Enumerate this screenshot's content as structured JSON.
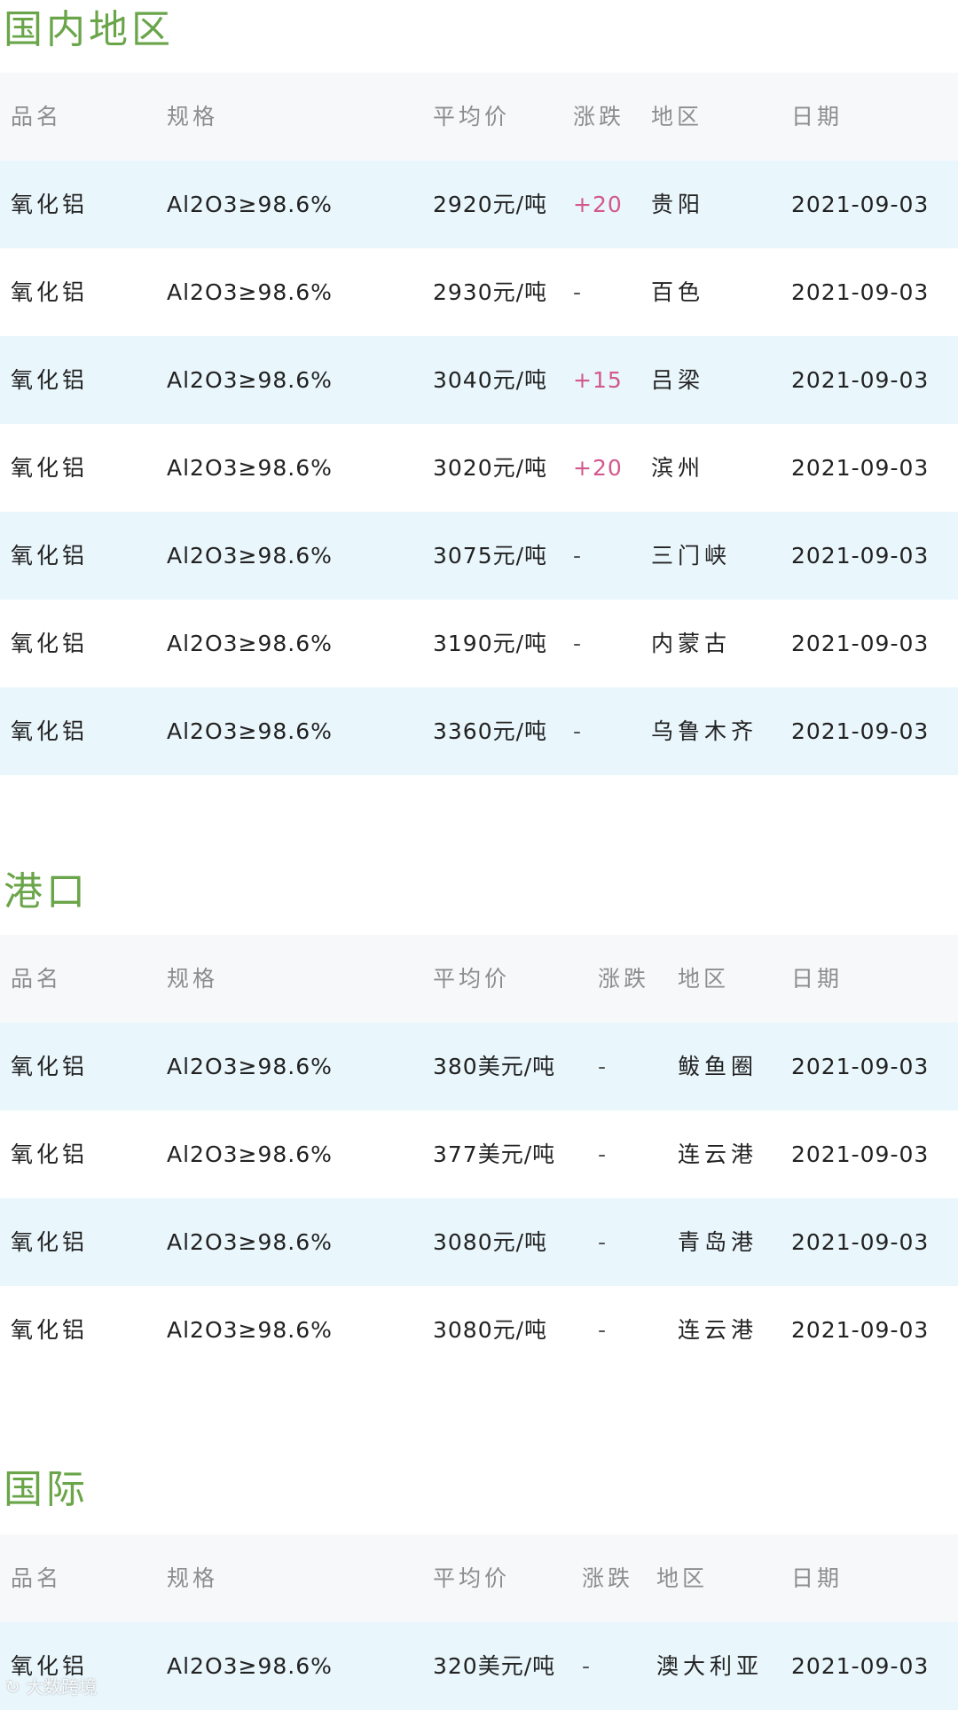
{
  "sections": [
    {
      "title": "国内地区",
      "headers": {
        "name": "品名",
        "spec": "规格",
        "price": "平均价",
        "change": "涨跌",
        "region": "地区",
        "date": "日期"
      },
      "rows": [
        {
          "name": "氧化铝",
          "spec": "Al2O3≥98.6%",
          "price": "2920元/吨",
          "change": "+20",
          "region": "贵阳",
          "date": "2021-09-03"
        },
        {
          "name": "氧化铝",
          "spec": "Al2O3≥98.6%",
          "price": "2930元/吨",
          "change": "-",
          "region": "百色",
          "date": "2021-09-03"
        },
        {
          "name": "氧化铝",
          "spec": "Al2O3≥98.6%",
          "price": "3040元/吨",
          "change": "+15",
          "region": "吕梁",
          "date": "2021-09-03"
        },
        {
          "name": "氧化铝",
          "spec": "Al2O3≥98.6%",
          "price": "3020元/吨",
          "change": "+20",
          "region": "滨州",
          "date": "2021-09-03"
        },
        {
          "name": "氧化铝",
          "spec": "Al2O3≥98.6%",
          "price": "3075元/吨",
          "change": "-",
          "region": "三门峡",
          "date": "2021-09-03"
        },
        {
          "name": "氧化铝",
          "spec": "Al2O3≥98.6%",
          "price": "3190元/吨",
          "change": "-",
          "region": "内蒙古",
          "date": "2021-09-03"
        },
        {
          "name": "氧化铝",
          "spec": "Al2O3≥98.6%",
          "price": "3360元/吨",
          "change": "-",
          "region": "乌鲁木齐",
          "date": "2021-09-03"
        }
      ]
    },
    {
      "title": "港口",
      "headers": {
        "name": "品名",
        "spec": "规格",
        "price": "平均价",
        "change": "涨跌",
        "region": "地区",
        "date": "日期"
      },
      "rows": [
        {
          "name": "氧化铝",
          "spec": "Al2O3≥98.6%",
          "price": "380美元/吨",
          "change": "-",
          "region": "鲅鱼圈",
          "date": "2021-09-03"
        },
        {
          "name": "氧化铝",
          "spec": "Al2O3≥98.6%",
          "price": "377美元/吨",
          "change": "-",
          "region": "连云港",
          "date": "2021-09-03"
        },
        {
          "name": "氧化铝",
          "spec": "Al2O3≥98.6%",
          "price": "3080元/吨",
          "change": "-",
          "region": "青岛港",
          "date": "2021-09-03"
        },
        {
          "name": "氧化铝",
          "spec": "Al2O3≥98.6%",
          "price": "3080元/吨",
          "change": "-",
          "region": "连云港",
          "date": "2021-09-03"
        }
      ]
    },
    {
      "title": "国际",
      "headers": {
        "name": "品名",
        "spec": "规格",
        "price": "平均价",
        "change": "涨跌",
        "region": "地区",
        "date": "日期"
      },
      "rows": [
        {
          "name": "氧化铝",
          "spec": "Al2O3≥98.6%",
          "price": "320美元/吨",
          "change": "-",
          "region": "澳大利亚",
          "date": "2021-09-03"
        }
      ]
    }
  ],
  "watermark": "大数跨境",
  "colors": {
    "title": "#6aa54a",
    "header_bg": "#f7f8fa",
    "shaded_row_bg": "#e9f6fc",
    "header_text": "#8d8d8d",
    "price_up": "#d2588e"
  }
}
